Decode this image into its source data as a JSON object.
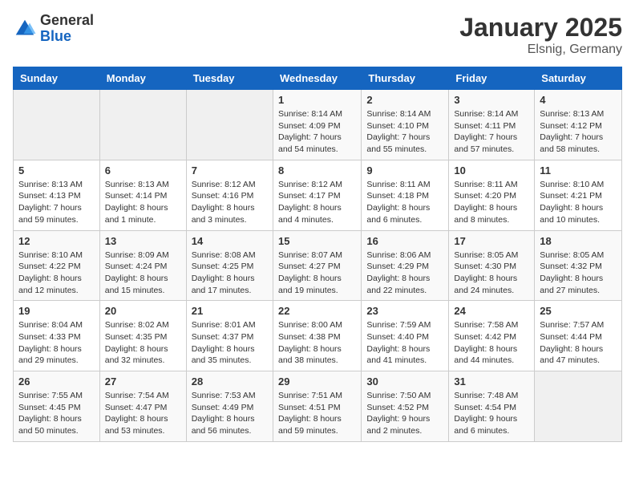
{
  "header": {
    "logo_general": "General",
    "logo_blue": "Blue",
    "month_title": "January 2025",
    "location": "Elsnig, Germany"
  },
  "weekdays": [
    "Sunday",
    "Monday",
    "Tuesday",
    "Wednesday",
    "Thursday",
    "Friday",
    "Saturday"
  ],
  "weeks": [
    [
      {
        "day": "",
        "sunrise": "",
        "sunset": "",
        "daylight": ""
      },
      {
        "day": "",
        "sunrise": "",
        "sunset": "",
        "daylight": ""
      },
      {
        "day": "",
        "sunrise": "",
        "sunset": "",
        "daylight": ""
      },
      {
        "day": "1",
        "sunrise": "Sunrise: 8:14 AM",
        "sunset": "Sunset: 4:09 PM",
        "daylight": "Daylight: 7 hours and 54 minutes."
      },
      {
        "day": "2",
        "sunrise": "Sunrise: 8:14 AM",
        "sunset": "Sunset: 4:10 PM",
        "daylight": "Daylight: 7 hours and 55 minutes."
      },
      {
        "day": "3",
        "sunrise": "Sunrise: 8:14 AM",
        "sunset": "Sunset: 4:11 PM",
        "daylight": "Daylight: 7 hours and 57 minutes."
      },
      {
        "day": "4",
        "sunrise": "Sunrise: 8:13 AM",
        "sunset": "Sunset: 4:12 PM",
        "daylight": "Daylight: 7 hours and 58 minutes."
      }
    ],
    [
      {
        "day": "5",
        "sunrise": "Sunrise: 8:13 AM",
        "sunset": "Sunset: 4:13 PM",
        "daylight": "Daylight: 7 hours and 59 minutes."
      },
      {
        "day": "6",
        "sunrise": "Sunrise: 8:13 AM",
        "sunset": "Sunset: 4:14 PM",
        "daylight": "Daylight: 8 hours and 1 minute."
      },
      {
        "day": "7",
        "sunrise": "Sunrise: 8:12 AM",
        "sunset": "Sunset: 4:16 PM",
        "daylight": "Daylight: 8 hours and 3 minutes."
      },
      {
        "day": "8",
        "sunrise": "Sunrise: 8:12 AM",
        "sunset": "Sunset: 4:17 PM",
        "daylight": "Daylight: 8 hours and 4 minutes."
      },
      {
        "day": "9",
        "sunrise": "Sunrise: 8:11 AM",
        "sunset": "Sunset: 4:18 PM",
        "daylight": "Daylight: 8 hours and 6 minutes."
      },
      {
        "day": "10",
        "sunrise": "Sunrise: 8:11 AM",
        "sunset": "Sunset: 4:20 PM",
        "daylight": "Daylight: 8 hours and 8 minutes."
      },
      {
        "day": "11",
        "sunrise": "Sunrise: 8:10 AM",
        "sunset": "Sunset: 4:21 PM",
        "daylight": "Daylight: 8 hours and 10 minutes."
      }
    ],
    [
      {
        "day": "12",
        "sunrise": "Sunrise: 8:10 AM",
        "sunset": "Sunset: 4:22 PM",
        "daylight": "Daylight: 8 hours and 12 minutes."
      },
      {
        "day": "13",
        "sunrise": "Sunrise: 8:09 AM",
        "sunset": "Sunset: 4:24 PM",
        "daylight": "Daylight: 8 hours and 15 minutes."
      },
      {
        "day": "14",
        "sunrise": "Sunrise: 8:08 AM",
        "sunset": "Sunset: 4:25 PM",
        "daylight": "Daylight: 8 hours and 17 minutes."
      },
      {
        "day": "15",
        "sunrise": "Sunrise: 8:07 AM",
        "sunset": "Sunset: 4:27 PM",
        "daylight": "Daylight: 8 hours and 19 minutes."
      },
      {
        "day": "16",
        "sunrise": "Sunrise: 8:06 AM",
        "sunset": "Sunset: 4:29 PM",
        "daylight": "Daylight: 8 hours and 22 minutes."
      },
      {
        "day": "17",
        "sunrise": "Sunrise: 8:05 AM",
        "sunset": "Sunset: 4:30 PM",
        "daylight": "Daylight: 8 hours and 24 minutes."
      },
      {
        "day": "18",
        "sunrise": "Sunrise: 8:05 AM",
        "sunset": "Sunset: 4:32 PM",
        "daylight": "Daylight: 8 hours and 27 minutes."
      }
    ],
    [
      {
        "day": "19",
        "sunrise": "Sunrise: 8:04 AM",
        "sunset": "Sunset: 4:33 PM",
        "daylight": "Daylight: 8 hours and 29 minutes."
      },
      {
        "day": "20",
        "sunrise": "Sunrise: 8:02 AM",
        "sunset": "Sunset: 4:35 PM",
        "daylight": "Daylight: 8 hours and 32 minutes."
      },
      {
        "day": "21",
        "sunrise": "Sunrise: 8:01 AM",
        "sunset": "Sunset: 4:37 PM",
        "daylight": "Daylight: 8 hours and 35 minutes."
      },
      {
        "day": "22",
        "sunrise": "Sunrise: 8:00 AM",
        "sunset": "Sunset: 4:38 PM",
        "daylight": "Daylight: 8 hours and 38 minutes."
      },
      {
        "day": "23",
        "sunrise": "Sunrise: 7:59 AM",
        "sunset": "Sunset: 4:40 PM",
        "daylight": "Daylight: 8 hours and 41 minutes."
      },
      {
        "day": "24",
        "sunrise": "Sunrise: 7:58 AM",
        "sunset": "Sunset: 4:42 PM",
        "daylight": "Daylight: 8 hours and 44 minutes."
      },
      {
        "day": "25",
        "sunrise": "Sunrise: 7:57 AM",
        "sunset": "Sunset: 4:44 PM",
        "daylight": "Daylight: 8 hours and 47 minutes."
      }
    ],
    [
      {
        "day": "26",
        "sunrise": "Sunrise: 7:55 AM",
        "sunset": "Sunset: 4:45 PM",
        "daylight": "Daylight: 8 hours and 50 minutes."
      },
      {
        "day": "27",
        "sunrise": "Sunrise: 7:54 AM",
        "sunset": "Sunset: 4:47 PM",
        "daylight": "Daylight: 8 hours and 53 minutes."
      },
      {
        "day": "28",
        "sunrise": "Sunrise: 7:53 AM",
        "sunset": "Sunset: 4:49 PM",
        "daylight": "Daylight: 8 hours and 56 minutes."
      },
      {
        "day": "29",
        "sunrise": "Sunrise: 7:51 AM",
        "sunset": "Sunset: 4:51 PM",
        "daylight": "Daylight: 8 hours and 59 minutes."
      },
      {
        "day": "30",
        "sunrise": "Sunrise: 7:50 AM",
        "sunset": "Sunset: 4:52 PM",
        "daylight": "Daylight: 9 hours and 2 minutes."
      },
      {
        "day": "31",
        "sunrise": "Sunrise: 7:48 AM",
        "sunset": "Sunset: 4:54 PM",
        "daylight": "Daylight: 9 hours and 6 minutes."
      },
      {
        "day": "",
        "sunrise": "",
        "sunset": "",
        "daylight": ""
      }
    ]
  ]
}
